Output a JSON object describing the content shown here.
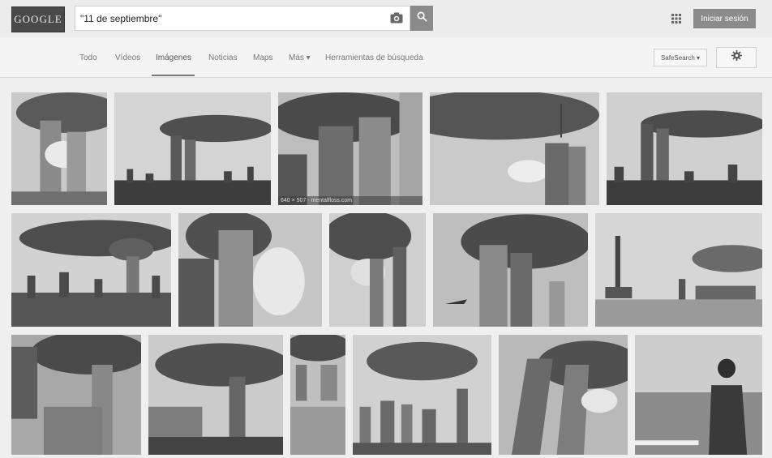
{
  "header": {
    "logo_text": "GOOGLE",
    "search_value": "\"11 de septiembre\"",
    "signin_label": "Iniciar sesión"
  },
  "nav": {
    "tabs": [
      "Todo",
      "Vídeos",
      "Imágenes",
      "Noticias",
      "Maps",
      "Más ▾",
      "Herramientas de búsqueda"
    ],
    "active_tab": "Imágenes",
    "safesearch_label": "SafeSearch ▾"
  },
  "results": {
    "image_caption": "640 × 507 - mentalfloss.com"
  },
  "icons": [
    "camera-icon",
    "search-icon",
    "apps-grid-icon",
    "gear-icon"
  ],
  "colors": {
    "accent": "#8a8a8a",
    "background": "#efefef"
  }
}
